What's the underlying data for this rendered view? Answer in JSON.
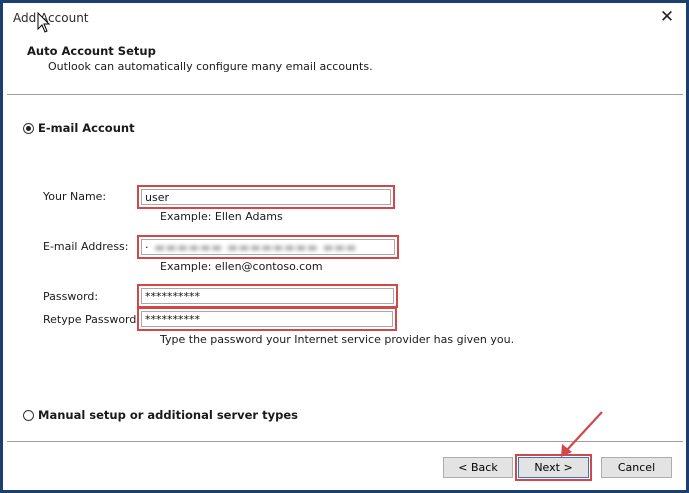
{
  "window": {
    "title": "Add Account"
  },
  "header": {
    "title": "Auto Account Setup",
    "subtitle": "Outlook can automatically configure many email accounts."
  },
  "options": {
    "email_account": "E-mail Account",
    "manual_setup": "Manual setup or additional server types"
  },
  "form": {
    "name": {
      "label": "Your Name:",
      "value": "user",
      "example": "Example: Ellen Adams"
    },
    "email": {
      "label": "E-mail Address:",
      "value": "·",
      "example": "Example: ellen@contoso.com"
    },
    "password": {
      "label": "Password:",
      "value": "**********"
    },
    "retype": {
      "label": "Retype Password:",
      "value": "**********"
    },
    "password_hint": "Type the password your Internet service provider has given you."
  },
  "buttons": {
    "back": "< Back",
    "next": "Next >",
    "cancel": "Cancel"
  },
  "colors": {
    "highlight": "#d24848",
    "frame": "#1d3f6e"
  }
}
